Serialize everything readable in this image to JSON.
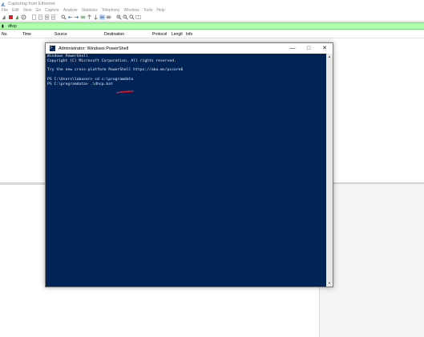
{
  "app": {
    "title": "Capturing from Ethernet"
  },
  "menu": {
    "items": [
      "File",
      "Edit",
      "View",
      "Go",
      "Capture",
      "Analyze",
      "Statistics",
      "Telephony",
      "Wireless",
      "Tools",
      "Help"
    ]
  },
  "toolbar": {
    "icons": [
      "shark-fin-icon",
      "stop-icon",
      "restart-icon",
      "options-gear-icon",
      "open-file-icon",
      "save-file-icon",
      "close-file-icon",
      "reload-icon",
      "find-icon",
      "back-icon",
      "forward-icon",
      "go-to-packet-icon",
      "first-packet-icon",
      "last-packet-icon",
      "autoscroll-icon",
      "colorize-icon",
      "zoom-in-icon",
      "zoom-out-icon",
      "normal-size-icon",
      "resize-columns-icon"
    ]
  },
  "filter": {
    "value": "dhcp",
    "color": "#afffaf"
  },
  "columns": [
    "No.",
    "Time",
    "Source",
    "Destination",
    "Protocol",
    "Lengtl",
    "Info"
  ],
  "powershell": {
    "title": "Administrator: Windows PowerShell",
    "controls": [
      "minimize",
      "maximize",
      "close"
    ],
    "lines": [
      "Windows PowerShell",
      "Copyright (C) Microsoft Corporation. All rights reserved.",
      "",
      "Try the new cross-platform PowerShell https://aka.ms/pscore6",
      "",
      "PS C:\\Users\\labuser> cd c:\\programdata",
      "PS C:\\programdata> .\\dhcp.bat"
    ],
    "background": "#012456",
    "annotation_color": "#e0202e"
  }
}
